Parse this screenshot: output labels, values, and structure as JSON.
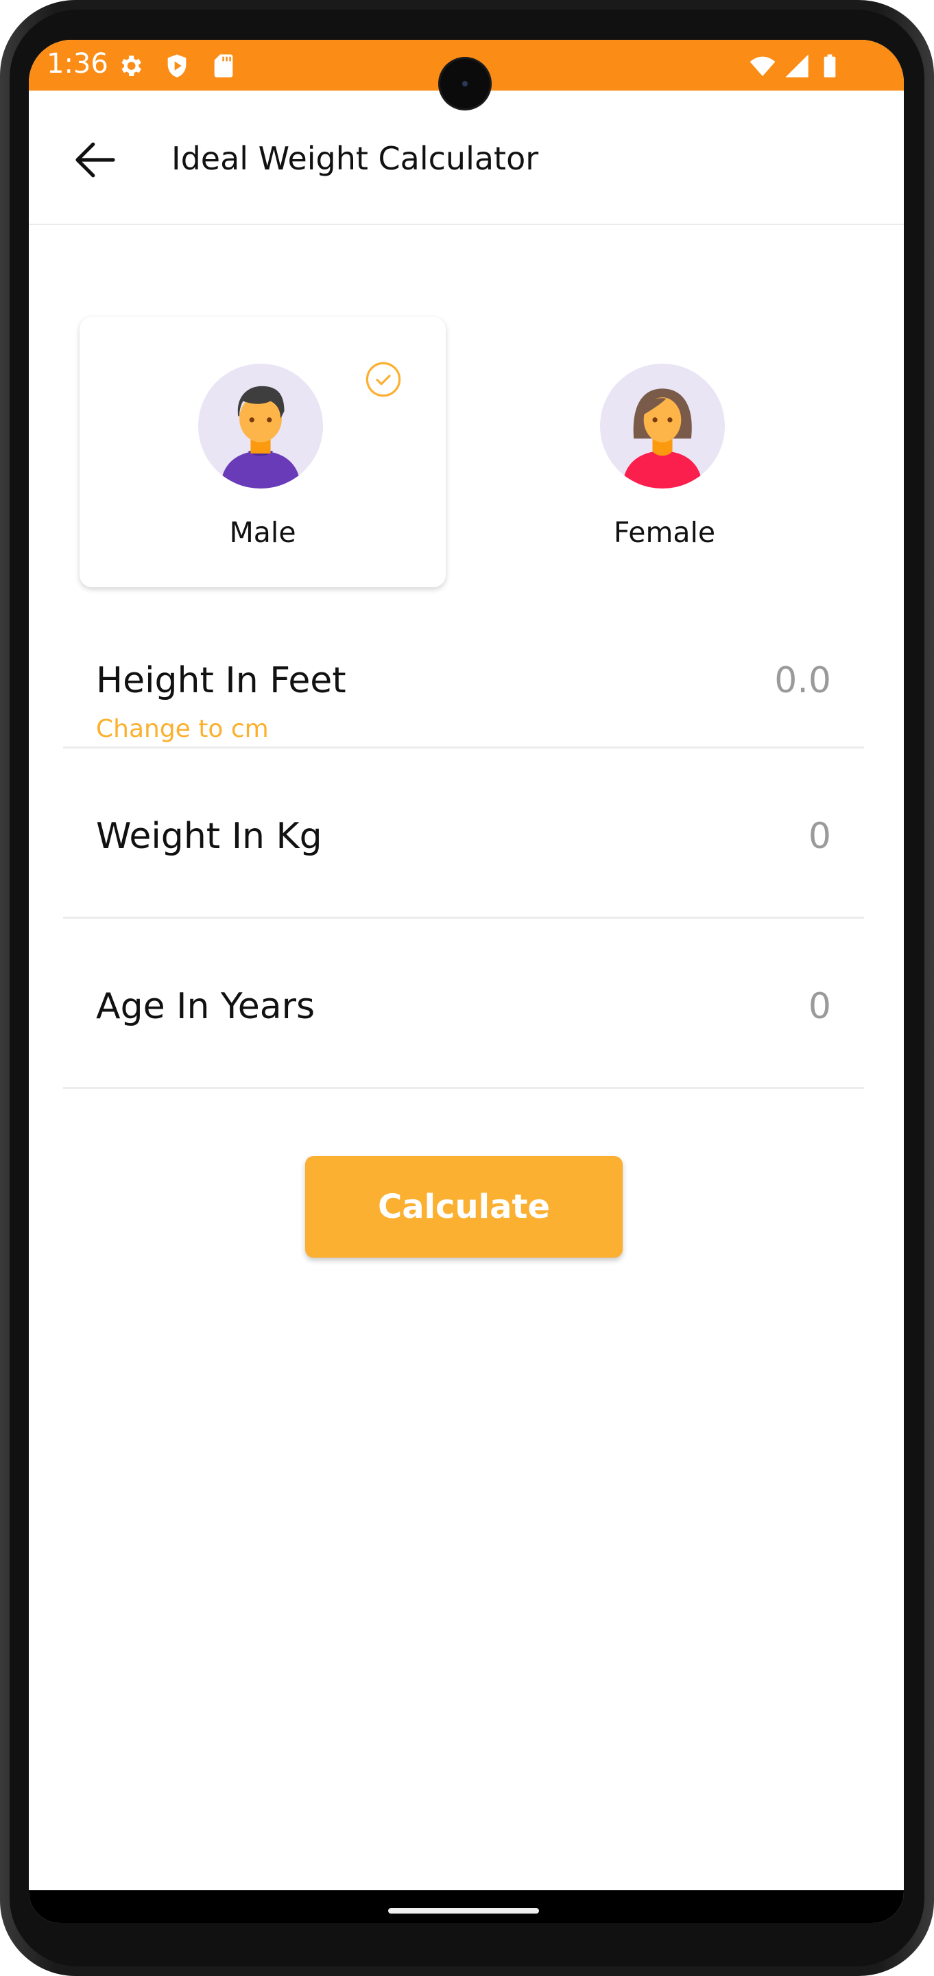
{
  "status_bar": {
    "time": "1:36",
    "left_icons": [
      "settings-icon",
      "shield-play-icon",
      "sd-card-icon"
    ],
    "right_icons": [
      "wifi-icon",
      "signal-icon",
      "battery-icon"
    ],
    "color": "#fb8c16"
  },
  "app_bar": {
    "title": "Ideal Weight Calculator",
    "back_icon": "arrow-left-icon"
  },
  "gender": {
    "selected": "Male",
    "options": [
      {
        "label": "Male",
        "icon": "male-avatar-icon",
        "selected": true
      },
      {
        "label": "Female",
        "icon": "female-avatar-icon",
        "selected": false
      }
    ]
  },
  "fields": [
    {
      "label": "Height In Feet",
      "value": "0.0",
      "link": "Change to cm"
    },
    {
      "label": "Weight In Kg",
      "value": "0"
    },
    {
      "label": "Age In Years",
      "value": "0"
    }
  ],
  "actions": {
    "calculate_label": "Calculate"
  },
  "colors": {
    "accent": "#fcb032",
    "status_bar": "#fb8c16",
    "value_text": "#9a9a9a"
  }
}
